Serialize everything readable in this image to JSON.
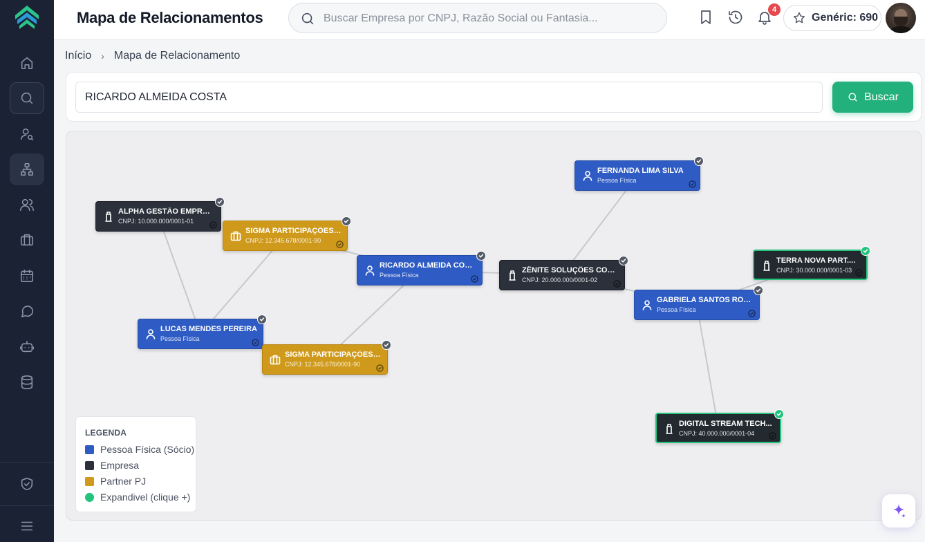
{
  "header": {
    "title": "Mapa de Relacionamentos",
    "search_placeholder": "Buscar Empresa por CNPJ, Razão Social ou Fantasia...",
    "notification_count": "4",
    "credits_label": "Genéric: 690"
  },
  "breadcrumb": {
    "home": "Início",
    "current": "Mapa de Relacionamento"
  },
  "search": {
    "value": "RICARDO ALMEIDA COSTA",
    "button_label": "Buscar"
  },
  "graph": {
    "nodes": [
      {
        "id": "alpha",
        "type": "empresa",
        "title": "ALPHA GESTÃO EMPRESA...",
        "subtitle": "CNPJ: 10.000.000/0001-01"
      },
      {
        "id": "sigma1",
        "type": "partner_pj",
        "title": "SIGMA PARTICIPAÇÕES LTDA",
        "subtitle": "CNPJ: 12.345.678/0001-90"
      },
      {
        "id": "ricardo",
        "type": "pessoa_fisica",
        "title": "RICARDO ALMEIDA COSTA",
        "subtitle": "Pessoa Física"
      },
      {
        "id": "zenite",
        "type": "empresa",
        "title": "ZÊNITE SOLUÇÕES CORP....",
        "subtitle": "CNPJ: 20.000.000/0001-02"
      },
      {
        "id": "fernanda",
        "type": "pessoa_fisica",
        "title": "FERNANDA LIMA SILVA",
        "subtitle": "Pessoa Física"
      },
      {
        "id": "terra",
        "type": "expandivel",
        "title": "TERRA NOVA PART....",
        "subtitle": "CNPJ: 30.000.000/0001-03"
      },
      {
        "id": "gabriela",
        "type": "pessoa_fisica",
        "title": "GABRIELA SANTOS ROCHA",
        "subtitle": "Pessoa Física"
      },
      {
        "id": "lucas",
        "type": "pessoa_fisica",
        "title": "LUCAS MENDES PEREIRA",
        "subtitle": "Pessoa Física"
      },
      {
        "id": "sigma2",
        "type": "partner_pj",
        "title": "SIGMA PARTICIPAÇÕES LTDA",
        "subtitle": "CNPJ: 12.345.678/0001-90"
      },
      {
        "id": "digital",
        "type": "expandivel",
        "title": "DIGITAL STREAM TECH...",
        "subtitle": "CNPJ: 40.000.000/0001-04"
      }
    ],
    "edges": [
      [
        "alpha",
        "lucas"
      ],
      [
        "sigma1",
        "lucas"
      ],
      [
        "sigma1",
        "ricardo"
      ],
      [
        "ricardo",
        "sigma2"
      ],
      [
        "ricardo",
        "zenite"
      ],
      [
        "zenite",
        "fernanda"
      ],
      [
        "zenite",
        "gabriela"
      ],
      [
        "gabriela",
        "terra"
      ],
      [
        "gabriela",
        "digital"
      ]
    ]
  },
  "legend": {
    "title": "LEGENDA",
    "items": [
      {
        "label": "Pessoa Física (Sócio)",
        "color": "#2f5cc4"
      },
      {
        "label": "Empresa",
        "color": "#2b303b"
      },
      {
        "label": "Partner PJ",
        "color": "#cf9a1b"
      },
      {
        "label": "Expandivel (clique +)",
        "color": "#23c27d"
      }
    ]
  },
  "colors": {
    "sidebar_bg": "#1b2233",
    "accent_green": "#22b07d",
    "pessoa_fisica": "#2f5cc4",
    "empresa": "#2b303b",
    "partner_pj": "#cf9a1b",
    "expandivel": "#23c27d"
  },
  "icons": {
    "sidebar": [
      "home-icon",
      "search-icon",
      "user-search-icon",
      "hierarchy-icon",
      "users-icon",
      "briefcase-icon",
      "calendar-icon",
      "chat-icon",
      "bot-icon",
      "database-icon",
      "shield-check-icon",
      "menu-icon"
    ],
    "header": [
      "search-icon",
      "bookmark-icon",
      "history-icon",
      "bell-icon",
      "star-icon"
    ]
  }
}
